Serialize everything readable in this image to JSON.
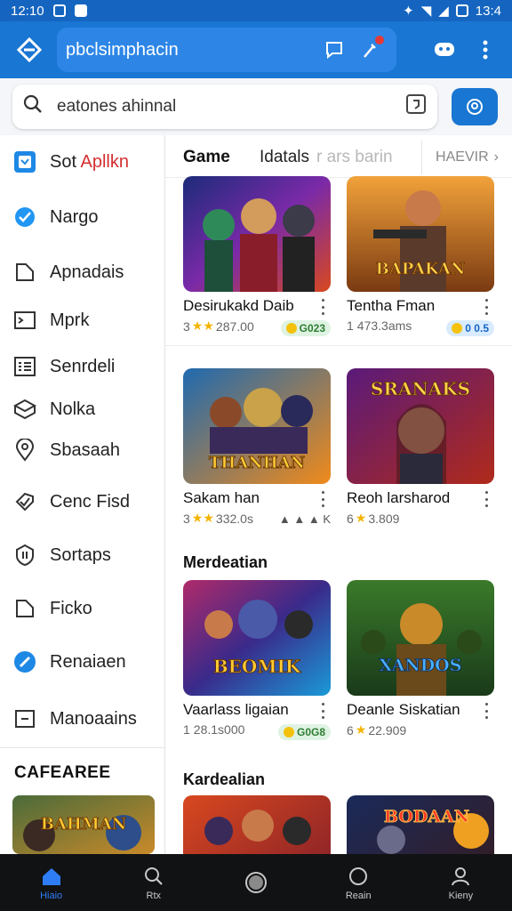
{
  "status_bar": {
    "time": "12:10",
    "right_time": "13:4"
  },
  "app_bar": {
    "search_text": "pbclsimphacin"
  },
  "search": {
    "query": "eatones ahinnal"
  },
  "sidebar": {
    "items": [
      {
        "label_a": "Sot ",
        "label_b": "Apllkn",
        "icon": "store-icon"
      },
      {
        "label": "Nargo",
        "icon": "verified-icon"
      },
      {
        "label": "Apnadais",
        "icon": "folder-icon"
      },
      {
        "label": "Mprk",
        "icon": "terminal-icon"
      },
      {
        "label": "Senrdeli",
        "icon": "list-icon"
      },
      {
        "label": "Nolka",
        "icon": "box-icon"
      },
      {
        "label": "Sbasaah",
        "icon": "location-pin-icon"
      },
      {
        "label": "Cenc Fisd",
        "icon": "tag-icon"
      },
      {
        "label": "Sortaps",
        "icon": "shield-icon"
      },
      {
        "label": "Ficko",
        "icon": "file-icon"
      },
      {
        "label": "Renaiaen",
        "icon": "compass-icon"
      },
      {
        "label": "Manoaains",
        "icon": "frame-icon"
      }
    ],
    "section_title": "CAFEAREE"
  },
  "tabs": {
    "t1": "Game",
    "t2": "Idatals",
    "t3": "r ars barin",
    "more": "HAEVIR"
  },
  "sections": {
    "s2": "Merdeatian",
    "s3": "Kardealian"
  },
  "cards": [
    {
      "title": "Desirukakd Daib",
      "meta_pre": "3",
      "stars": "★★",
      "meta": "287.00",
      "badge": "G023"
    },
    {
      "title": "Tentha Fman",
      "meta_pre": "1",
      "stars": "",
      "meta": "473.3ams",
      "badge": "0 0.5"
    },
    {
      "title": "Sakam han",
      "meta_pre": "3",
      "stars": "★★",
      "meta": "332.0s",
      "tags": "▲ ▲ ▲ K"
    },
    {
      "title": "Reoh larsharod",
      "meta_pre": "6",
      "stars": "★",
      "meta": "3.809",
      "tags": ""
    },
    {
      "title": "Vaarlass ligaian",
      "meta_pre": "1",
      "stars": "",
      "meta": "28.1s000",
      "badge": "G0G8"
    },
    {
      "title": "Deanle Siskatian",
      "meta_pre": "6",
      "stars": "★",
      "meta": "22.909",
      "tags": ""
    }
  ],
  "art_text": {
    "a1": "BAPAKAN",
    "a2": "THANHAN",
    "a3": "SRANAKS",
    "a4": "BEOMIK",
    "a5": "XANDOS",
    "a6": "BAHMAN",
    "a7": "BODAAN"
  },
  "bottom_nav": [
    "Hiaio",
    "Rtx",
    "",
    "Reain",
    "Kieny"
  ]
}
